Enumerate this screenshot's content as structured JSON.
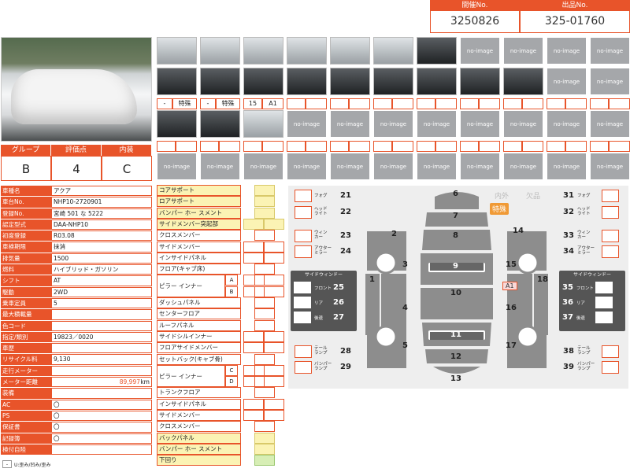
{
  "header": {
    "session_label": "開催No.",
    "session_value": "3250826",
    "lot_label": "出品No.",
    "lot_value": "325-01760"
  },
  "photos": {
    "no_image_label": "no-image",
    "tags": [
      "-",
      "特殊",
      "-",
      "特殊",
      "15",
      "A1"
    ]
  },
  "grade": {
    "headers": [
      "グループ",
      "評価点",
      "内装"
    ],
    "values": [
      "B",
      "4",
      "C"
    ]
  },
  "info": [
    {
      "k": "車種名",
      "v": "アクア"
    },
    {
      "k": "車台No.",
      "v": "NHP10-2720901"
    },
    {
      "k": "登録No.",
      "v": "宮崎 501 な 5222"
    },
    {
      "k": "認定型式",
      "v": "DAA-NHP10"
    },
    {
      "k": "初度登録",
      "v": "R03.08"
    },
    {
      "k": "車検期限",
      "v": "抹消"
    },
    {
      "k": "排気量",
      "v": "1500"
    },
    {
      "k": "燃料",
      "v": "ハイブリッド・ガソリン"
    },
    {
      "k": "シフト",
      "v": "AT"
    },
    {
      "k": "駆動",
      "v": "2WD"
    },
    {
      "k": "乗車定員",
      "v": "5"
    },
    {
      "k": "最大積載量",
      "v": ""
    },
    {
      "k": "色コード",
      "v": ""
    },
    {
      "k": "指定/類別",
      "v": "19823／0020"
    },
    {
      "k": "車歴",
      "v": ""
    },
    {
      "k": "リサイクル料",
      "v": "9,130"
    },
    {
      "k": "走行メーター",
      "v": ""
    },
    {
      "k": "メーター距離",
      "v": "",
      "mileage": "89,997",
      "unit": "km"
    },
    {
      "k": "装備",
      "v": ""
    },
    {
      "k": "AC",
      "v": "〇"
    },
    {
      "k": "PS",
      "v": "〇"
    },
    {
      "k": "保証書",
      "v": "〇"
    },
    {
      "k": "記録簿",
      "v": "〇"
    },
    {
      "k": "検付自陸",
      "v": ""
    }
  ],
  "legend": {
    "box": "-",
    "text": "U:歪み/凹み/歪み"
  },
  "parts": [
    {
      "label": "コアサポート",
      "y": true
    },
    {
      "label": "ロアサポート",
      "y": true
    },
    {
      "label": "バンパー ホー スメント",
      "y": true
    },
    {
      "label": "サイドメンバー突起部",
      "y": true
    },
    {
      "label": "クロスメンバー",
      "y": false
    },
    {
      "label": "サイドメンバー",
      "y": false
    },
    {
      "label": "インサイドパネル",
      "y": false
    },
    {
      "label": "フロア(キャブ床)",
      "y": false
    },
    {
      "label": "ダッシュパネル",
      "y": false
    },
    {
      "label": "センターフロア",
      "y": false
    },
    {
      "label": "ルーフパネル",
      "y": false
    },
    {
      "label": "サイドシルインナー",
      "y": false
    },
    {
      "label": "フロアサイドメンバー",
      "y": false
    },
    {
      "label": "セットバック(キャブ骨)",
      "y": false
    },
    {
      "label": "トランクフロア",
      "y": false
    },
    {
      "label": "インサイドパネル",
      "y": false
    },
    {
      "label": "サイドメンバー",
      "y": false
    },
    {
      "label": "クロスメンバー",
      "y": false
    },
    {
      "label": "バックパネル",
      "y": true
    },
    {
      "label": "バンパー ホー スメント",
      "y": true
    },
    {
      "label": "下回り",
      "y": true
    }
  ],
  "pillars": {
    "front_label": "ピラー インナー",
    "rear_label": "ピラー インナー",
    "sub": [
      "A",
      "B",
      "C",
      "D"
    ]
  },
  "diagram": {
    "inner": "内外",
    "missing": "欠品",
    "special": "特殊",
    "damage_tag": "A1",
    "side_window_title": "サイドウィンドー",
    "left_labels": [
      {
        "t": "フォグ",
        "n": "21"
      },
      {
        "t": "ヘッド\nライト",
        "n": "22"
      },
      {
        "t": "ウィン\nカー",
        "n": "23"
      },
      {
        "t": "アウター\nミラー",
        "n": "24"
      },
      {
        "t": "テール\nランプ",
        "n": "28"
      },
      {
        "t": "バンパー\nランプ",
        "n": "29"
      }
    ],
    "right_labels": [
      {
        "t": "フォグ",
        "n": "31"
      },
      {
        "t": "ヘッド\nライト",
        "n": "32"
      },
      {
        "t": "ウィン\nカー",
        "n": "33"
      },
      {
        "t": "アウター\nミラー",
        "n": "34"
      },
      {
        "t": "テール\nランプ",
        "n": "38"
      },
      {
        "t": "バンパー\nランプ",
        "n": "39"
      }
    ],
    "left_window": [
      {
        "t": "フロント",
        "n": "25"
      },
      {
        "t": "リア",
        "n": "26"
      },
      {
        "t": "後退",
        "n": "27"
      }
    ],
    "right_window": [
      {
        "t": "フロント",
        "n": "35"
      },
      {
        "t": "リア",
        "n": "36"
      },
      {
        "t": "後退",
        "n": "37"
      }
    ],
    "panel_numbers": [
      "1",
      "2",
      "3",
      "4",
      "5",
      "6",
      "7",
      "8",
      "9",
      "10",
      "11",
      "12",
      "13",
      "14",
      "15",
      "16",
      "17",
      "18"
    ]
  }
}
